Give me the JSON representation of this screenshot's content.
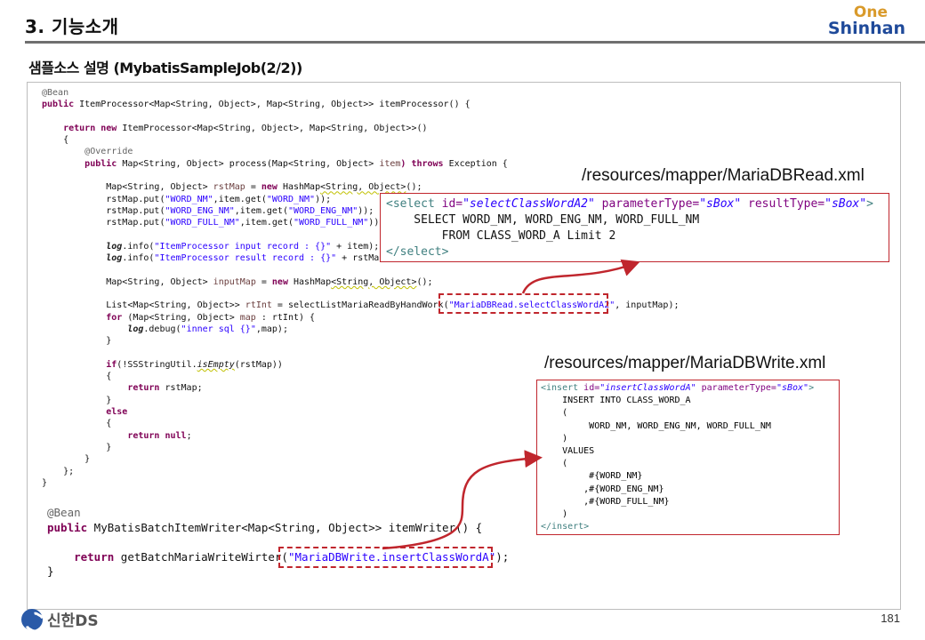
{
  "header": {
    "section_title": "3. 기능소개",
    "logo_top": "One",
    "logo_bottom": "Shinhan",
    "subtitle": "샘플소스 설명 (MybatisSampleJob(2/2))"
  },
  "code": {
    "l01": "@Bean",
    "l02_kw": "public",
    "l02": " ItemProcessor<Map<String, Object>, Map<String, Object>> itemProcessor() {",
    "l04_kw": "return new",
    "l04": " ItemProcessor<Map<String, Object>, Map<String, Object>>()",
    "l05": "{",
    "l06": "@Override",
    "l07_kw": "public",
    "l07a": " Map<String, Object> process(Map<String, Object> ",
    "l07_var": "item",
    "l07_kw2": ") throws",
    "l07b": " Exception {",
    "l09a": "Map<String, Object> ",
    "l09_var": "rstMap",
    "l09b": " = ",
    "l09_kw": "new",
    "l09c": " HashMap",
    "l09_und": "<String, Object>",
    "l09d": "();",
    "l10a": "rstMap.put(",
    "l10_s1": "\"WORD_NM\"",
    "l10b": ",item.get(",
    "l10_s2": "\"WORD_NM\"",
    "l10c": "));",
    "l11a": "rstMap.put(",
    "l11_s1": "\"WORD_ENG_NM\"",
    "l11b": ",item.get(",
    "l11_s2": "\"WORD_ENG_NM\"",
    "l11c": "));",
    "l12a": "rstMap.put(",
    "l12_s1": "\"WORD_FULL_NM\"",
    "l12b": ",item.get(",
    "l12_s2": "\"WORD_FULL_NM\"",
    "l12c": "))",
    "l14_log": "log",
    "l14a": ".info(",
    "l14_s": "\"ItemProcessor input record : {}\"",
    "l14b": " + item);",
    "l15_log": "log",
    "l15a": ".info(",
    "l15_s": "\"ItemProcessor result record : {}\"",
    "l15b": " + rstMap);",
    "l17a": "Map<String, Object> ",
    "l17_var": "inputMap",
    "l17b": " = ",
    "l17_kw": "new",
    "l17c": " HashMap",
    "l17_und": "<String, Object>",
    "l17d": "();",
    "l19a": "List<Map<String, Object>> ",
    "l19_var": "rtInt",
    "l19b": " = selectListMariaReadByHandWork(",
    "l19_s": "\"MariaDBRead.selectClassWordA2\"",
    "l19c": ", inputMap);",
    "l20_kw": "for",
    "l20a": " (Map<String, Object> ",
    "l20_var": "map",
    "l20b": " : rtInt) {",
    "l21_log": "log",
    "l21a": ".debug(",
    "l21_s": "\"inner sql {}\"",
    "l21b": ",map);",
    "l22": "}",
    "l24_kw": "if",
    "l24a": "(!SSStringUtil.",
    "l24_static": "isEmpty",
    "l24b": "(rstMap))",
    "l25": "{",
    "l26_kw": "return",
    "l26": " rstMap;",
    "l27": "}",
    "l28_kw": "else",
    "l29": "{",
    "l30_kw": "return null",
    "l30": ";",
    "l31": "}",
    "l32": "}",
    "l33": "};",
    "l34": "}",
    "w1": "@Bean",
    "w2_kw": "public",
    "w2": " MyBatisBatchItemWriter<Map<String, Object>> itemWriter() {",
    "w4_kw": "return",
    "w4a": " getBatchMariaWriteWirter(",
    "w4_s": "\"MariaDBWrite.insertClassWordA\"",
    "w4b": ");",
    "w5": "}"
  },
  "read_xml": {
    "path": "/resources/mapper/MariaDBRead.xml",
    "open_tag": "<select",
    "attr1": " id=",
    "val1": "\"selectClassWordA2\"",
    "attr2": " parameterType=",
    "val2": "\"sBox\"",
    "attr3": " resultType=",
    "val3": "\"sBox\"",
    "close_bracket": ">",
    "sql1": "    SELECT WORD_NM, WORD_ENG_NM, WORD_FULL_NM",
    "sql2": "        FROM CLASS_WORD_A Limit 2",
    "end_tag": "</select>"
  },
  "write_xml": {
    "path": "/resources/mapper/MariaDBWrite.xml",
    "open_tag": "<insert",
    "attr1": " id=",
    "val1": "\"insertClassWordA\"",
    "attr2": " parameterType=",
    "val2": "\"sBox\"",
    "close_bracket": ">",
    "s1": "    INSERT INTO CLASS_WORD_A",
    "s2": "    (",
    "s3": "         WORD_NM, WORD_ENG_NM, WORD_FULL_NM",
    "s4": "    )",
    "s5": "    VALUES",
    "s6": "    (",
    "s7": "         #{WORD_NM}",
    "s8": "        ,#{WORD_ENG_NM}",
    "s9": "        ,#{WORD_FULL_NM}",
    "s10": "    )",
    "end_tag": "</insert>"
  },
  "footer": {
    "brand": "신한DS",
    "page_number": "181"
  },
  "colors": {
    "accent_red": "#c0262d",
    "brand_blue": "#1f4a9a",
    "brand_gold": "#d99a2b"
  }
}
